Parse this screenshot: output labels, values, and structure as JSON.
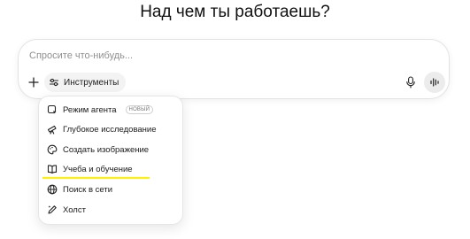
{
  "heading": "Над чем ты работаешь?",
  "composer": {
    "placeholder": "Спросите что-нибудь...",
    "tools_label": "Инструменты"
  },
  "menu": {
    "items": [
      {
        "label": "Режим агента",
        "badge": "НОВЫЙ",
        "icon": "agent-icon"
      },
      {
        "label": "Глубокое исследование",
        "icon": "telescope-icon"
      },
      {
        "label": "Создать изображение",
        "icon": "palette-icon"
      },
      {
        "label": "Учеба и обучение",
        "icon": "book-icon"
      },
      {
        "label": "Поиск в сети",
        "icon": "globe-icon"
      },
      {
        "label": "Холст",
        "icon": "pen-icon"
      }
    ]
  },
  "colors": {
    "highlight": "#fff200",
    "voice_button_bg": "#ececec",
    "tools_button_bg": "#f3f3f3"
  }
}
